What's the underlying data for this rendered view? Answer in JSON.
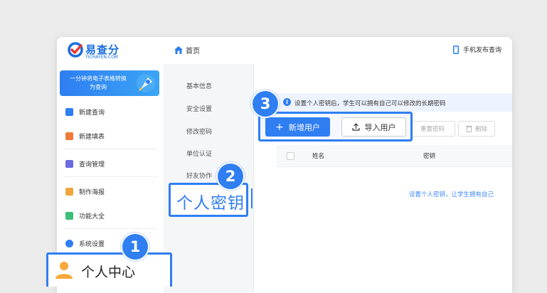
{
  "app": {
    "logo_text": "易查分",
    "logo_sub": "YICHAFEN.COM"
  },
  "topbar": {
    "home_label": "首页",
    "mobile_label": "手机发布查询"
  },
  "sidebar": {
    "promo_text": "一分钟将电子表格转换为查询",
    "items": [
      {
        "label": "新建查询",
        "icon": "new-query-icon",
        "color": "#2f7ef2"
      },
      {
        "label": "新建填表",
        "icon": "new-form-icon",
        "color": "#f07a3a"
      },
      {
        "label": "查询管理",
        "icon": "query-manage-icon",
        "color": "#6b6be0"
      },
      {
        "label": "制作海报",
        "icon": "poster-icon",
        "color": "#f0a63a"
      },
      {
        "label": "功能大全",
        "icon": "features-icon",
        "color": "#3bbf7a"
      },
      {
        "label": "系统设置",
        "icon": "settings-icon",
        "color": "#2f7ef2"
      }
    ],
    "highlight_label": "个人中心"
  },
  "subnav": {
    "items": [
      "基本信息",
      "安全设置",
      "修改密码",
      "单位认证",
      "好友协作"
    ],
    "highlight_label": "个人密钥"
  },
  "main": {
    "tip": "设置个人密钥后，学生可以拥有自己可以修改的长期密码",
    "buttons": {
      "new_user": "新增用户",
      "import_user": "导入用户",
      "reset": "重置密码",
      "delete": "删除"
    },
    "table": {
      "columns": [
        "姓名",
        "密钥"
      ]
    },
    "empty_text": "设置个人密钥，让学生拥有自己"
  },
  "steps": {
    "one": "1",
    "two": "2",
    "three": "3"
  },
  "colors": {
    "accent": "#2f7ef2"
  }
}
